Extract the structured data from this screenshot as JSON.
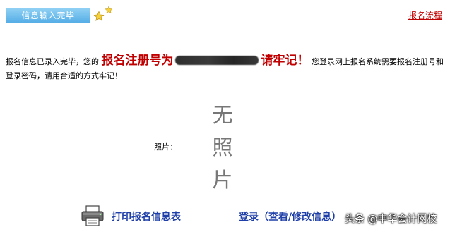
{
  "header": {
    "tab_label": "信息输入完毕",
    "flow_link": "报名流程"
  },
  "message": {
    "part1": "报名信息已录入完毕，您的",
    "reg_label": "报名注册号为",
    "reg_suffix": "请牢记！",
    "part2": "您登录网上报名系统需要报名注册号和登录密码，请用合适的方式牢记！"
  },
  "photo": {
    "label": "照片：",
    "placeholder": [
      "无",
      "照",
      "片"
    ]
  },
  "actions": {
    "print_label": "打印报名信息表",
    "login_label": "登录（查看/修改信息）"
  },
  "watermark": {
    "text": "头条 @中华会计网校"
  },
  "colors": {
    "tab_blue": "#55aee6",
    "alert_red": "#c00000",
    "link_blue": "#1f3fa8",
    "star_yellow": "#f7d23a"
  }
}
